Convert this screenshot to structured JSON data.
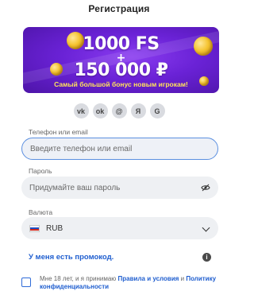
{
  "header": {
    "title": "Регистрация"
  },
  "banner": {
    "line1": "1000 FS",
    "line2": "+",
    "line3": "150 000 ₽",
    "subtitle": "Самый большой бонус новым игрокам!"
  },
  "socials": [
    {
      "icon": "vk-icon",
      "glyph": "vk"
    },
    {
      "icon": "odnoklassniki-icon",
      "glyph": "ok"
    },
    {
      "icon": "mail-icon",
      "glyph": "@"
    },
    {
      "icon": "yandex-icon",
      "glyph": "Я"
    },
    {
      "icon": "google-icon",
      "glyph": "G"
    }
  ],
  "form": {
    "phone_label": "Телефон или email",
    "phone_placeholder": "Введите телефон или email",
    "password_label": "Пароль",
    "password_placeholder": "Придумайте ваш пароль",
    "currency_label": "Валюта",
    "currency_value": "RUB"
  },
  "promo": {
    "label": "У меня есть промокод."
  },
  "terms": {
    "prefix": "Мне 18 лет, и я принимаю ",
    "link1": "Правила и условия",
    "middle": " и ",
    "link2": "Политику конфиденциальности"
  },
  "colors": {
    "accent": "#1f5ecf",
    "banner": "#6a22d6",
    "field": "#eef0f3"
  }
}
